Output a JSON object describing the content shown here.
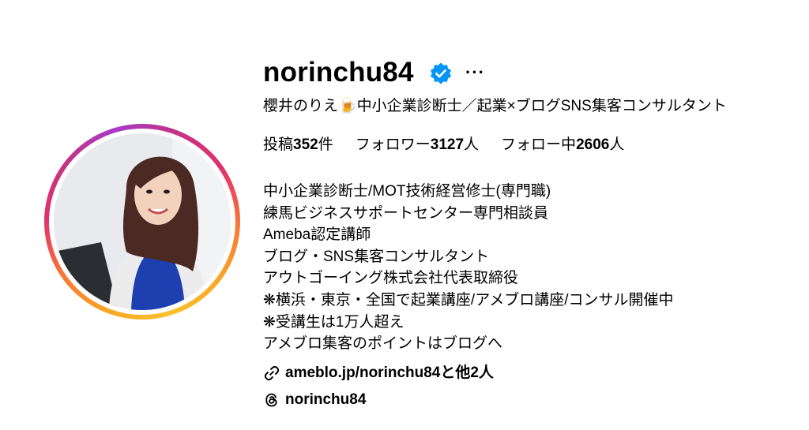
{
  "profile": {
    "username": "norinchu84",
    "full_name": "櫻井のりえ🍺中小企業診断士／起業×ブログSNS集客コンサルタント",
    "verified_icon": "verified-badge-icon",
    "more_icon": "more-options-icon",
    "more_label": "···"
  },
  "stats": {
    "posts_label": "投稿",
    "posts_value": "352",
    "posts_unit": "件",
    "followers_label": "フォロワー",
    "followers_value": "3127",
    "followers_unit": "人",
    "following_label": "フォロー中",
    "following_value": "2606",
    "following_unit": "人"
  },
  "bio": [
    "中小企業診断士/MOT技術経営修士(専門職)",
    "練馬ビジネスサポートセンター専門相談員",
    "Ameba認定講師",
    "ブログ・SNS集客コンサルタント",
    "アウトゴーイング株式会社代表取締役",
    "❋横浜・東京・全国で起業講座/アメブロ講座/コンサル開催中",
    "❋受講生は1万人超え",
    "アメブロ集客のポイントはブログへ"
  ],
  "links": {
    "link_icon": "link-icon",
    "link_text": "ameblo.jp/norinchu84と他2人",
    "threads_icon": "threads-icon",
    "threads_text": "norinchu84"
  },
  "colors": {
    "verified_blue": "#0095f6",
    "ring_orange": "#f9a825",
    "ring_pink": "#e1306c",
    "ring_purple": "#c13584"
  }
}
